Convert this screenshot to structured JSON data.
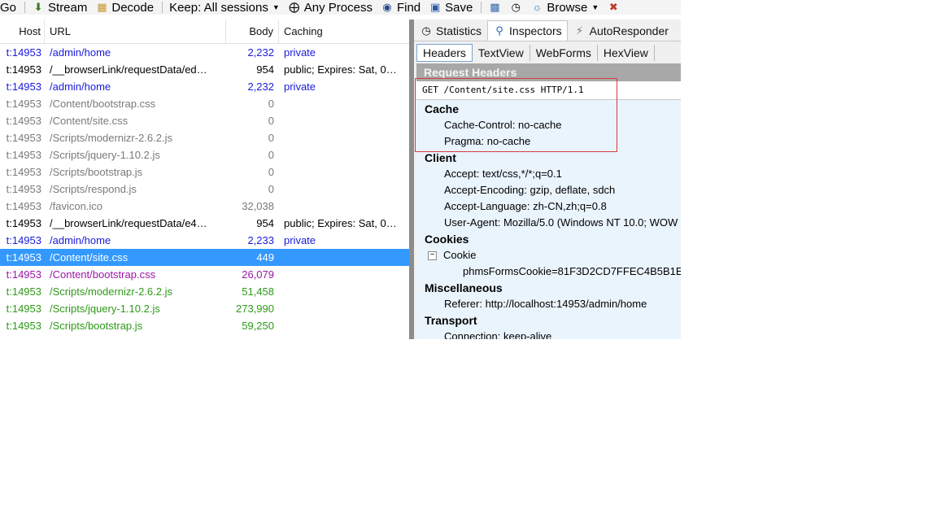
{
  "toolbar": {
    "go": "Go",
    "stream": "Stream",
    "decode": "Decode",
    "keep": "Keep: All sessions",
    "any_process": "Any Process",
    "find": "Find",
    "save": "Save",
    "browse": "Browse"
  },
  "columns": {
    "host": "Host",
    "url": "URL",
    "body": "Body",
    "caching": "Caching"
  },
  "sessions": [
    {
      "host": "t:14953",
      "url": "/admin/home",
      "body": "2,232",
      "caching": "private",
      "style": "blue"
    },
    {
      "host": "t:14953",
      "url": "/__browserLink/requestData/ed…",
      "body": "954",
      "caching": "public; Expires: Sat, 0…",
      "style": "black"
    },
    {
      "host": "t:14953",
      "url": "/admin/home",
      "body": "2,232",
      "caching": "private",
      "style": "blue"
    },
    {
      "host": "t:14953",
      "url": "/Content/bootstrap.css",
      "body": "0",
      "caching": "",
      "style": "gray"
    },
    {
      "host": "t:14953",
      "url": "/Content/site.css",
      "body": "0",
      "caching": "",
      "style": "gray"
    },
    {
      "host": "t:14953",
      "url": "/Scripts/modernizr-2.6.2.js",
      "body": "0",
      "caching": "",
      "style": "gray"
    },
    {
      "host": "t:14953",
      "url": "/Scripts/jquery-1.10.2.js",
      "body": "0",
      "caching": "",
      "style": "gray"
    },
    {
      "host": "t:14953",
      "url": "/Scripts/bootstrap.js",
      "body": "0",
      "caching": "",
      "style": "gray"
    },
    {
      "host": "t:14953",
      "url": "/Scripts/respond.js",
      "body": "0",
      "caching": "",
      "style": "gray"
    },
    {
      "host": "t:14953",
      "url": "/favicon.ico",
      "body": "32,038",
      "caching": "",
      "style": "gray"
    },
    {
      "host": "t:14953",
      "url": "/__browserLink/requestData/e4…",
      "body": "954",
      "caching": "public; Expires: Sat, 0…",
      "style": "black"
    },
    {
      "host": "t:14953",
      "url": "/admin/home",
      "body": "2,233",
      "caching": "private",
      "style": "blue"
    },
    {
      "host": "t:14953",
      "url": "/Content/site.css",
      "body": "449",
      "caching": "",
      "style": "selected"
    },
    {
      "host": "t:14953",
      "url": "/Content/bootstrap.css",
      "body": "26,079",
      "caching": "",
      "style": "purple"
    },
    {
      "host": "t:14953",
      "url": "/Scripts/modernizr-2.6.2.js",
      "body": "51,458",
      "caching": "",
      "style": "green"
    },
    {
      "host": "t:14953",
      "url": "/Scripts/jquery-1.10.2.js",
      "body": "273,990",
      "caching": "",
      "style": "green"
    },
    {
      "host": "t:14953",
      "url": "/Scripts/bootstrap.js",
      "body": "59,250",
      "caching": "",
      "style": "green"
    }
  ],
  "inspector": {
    "tabs": {
      "statistics": "Statistics",
      "inspectors": "Inspectors",
      "autoresponder": "AutoResponder"
    },
    "subtabs": {
      "headers": "Headers",
      "textview": "TextView",
      "webforms": "WebForms",
      "hexview": "HexView"
    },
    "section_title": "Request Headers",
    "request_line": "GET /Content/site.css HTTP/1.1",
    "groups": {
      "cache": {
        "title": "Cache",
        "items": [
          "Cache-Control: no-cache",
          "Pragma: no-cache"
        ]
      },
      "client": {
        "title": "Client",
        "items": [
          "Accept: text/css,*/*;q=0.1",
          "Accept-Encoding: gzip, deflate, sdch",
          "Accept-Language: zh-CN,zh;q=0.8",
          "User-Agent: Mozilla/5.0 (Windows NT 10.0; WOW"
        ]
      },
      "cookies": {
        "title": "Cookies",
        "cookie_node": "Cookie",
        "cookie_value": "phmsFormsCookie=81F3D2CD7FFEC4B5B1E"
      },
      "misc": {
        "title": "Miscellaneous",
        "items": [
          "Referer: http://localhost:14953/admin/home"
        ]
      },
      "transport": {
        "title": "Transport",
        "items": [
          "Connection: keep-alive"
        ]
      }
    }
  },
  "colors": {
    "selected_row": "#3399ff",
    "highlight_box": "#d43c3c",
    "link_blue": "#1a1adb",
    "success_green": "#2e9a17",
    "css_purple": "#9b16a5"
  }
}
